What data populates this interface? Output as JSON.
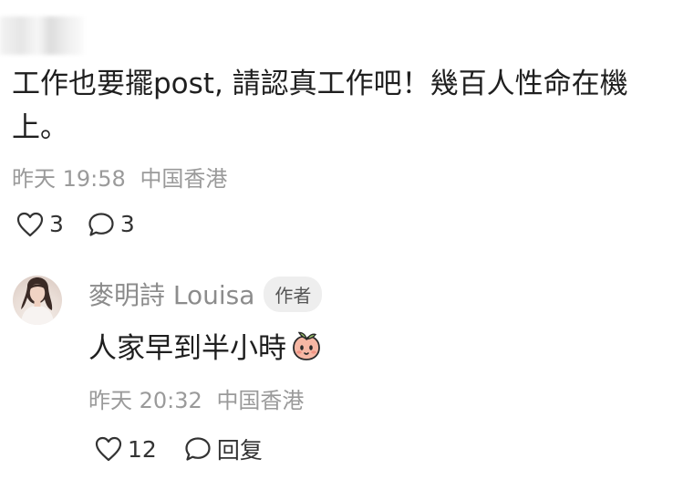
{
  "comment": {
    "text": "工作也要擺post, 請認真工作吧！幾百人性命在機上。",
    "time": "昨天 19:58",
    "location": "中国香港",
    "likes": "3",
    "replies": "3"
  },
  "reply": {
    "author": "麥明詩 Louisa",
    "badge": "作者",
    "text": "人家早到半小時",
    "time": "昨天 20:32",
    "location": "中国香港",
    "likes": "12",
    "reply_label": "回复",
    "emoji": "peach-sticker-icon"
  },
  "colors": {
    "text": "#1f1f1f",
    "meta": "#9a9a9a",
    "badge_bg": "#eeeeee",
    "peach": "#f2a38d"
  }
}
